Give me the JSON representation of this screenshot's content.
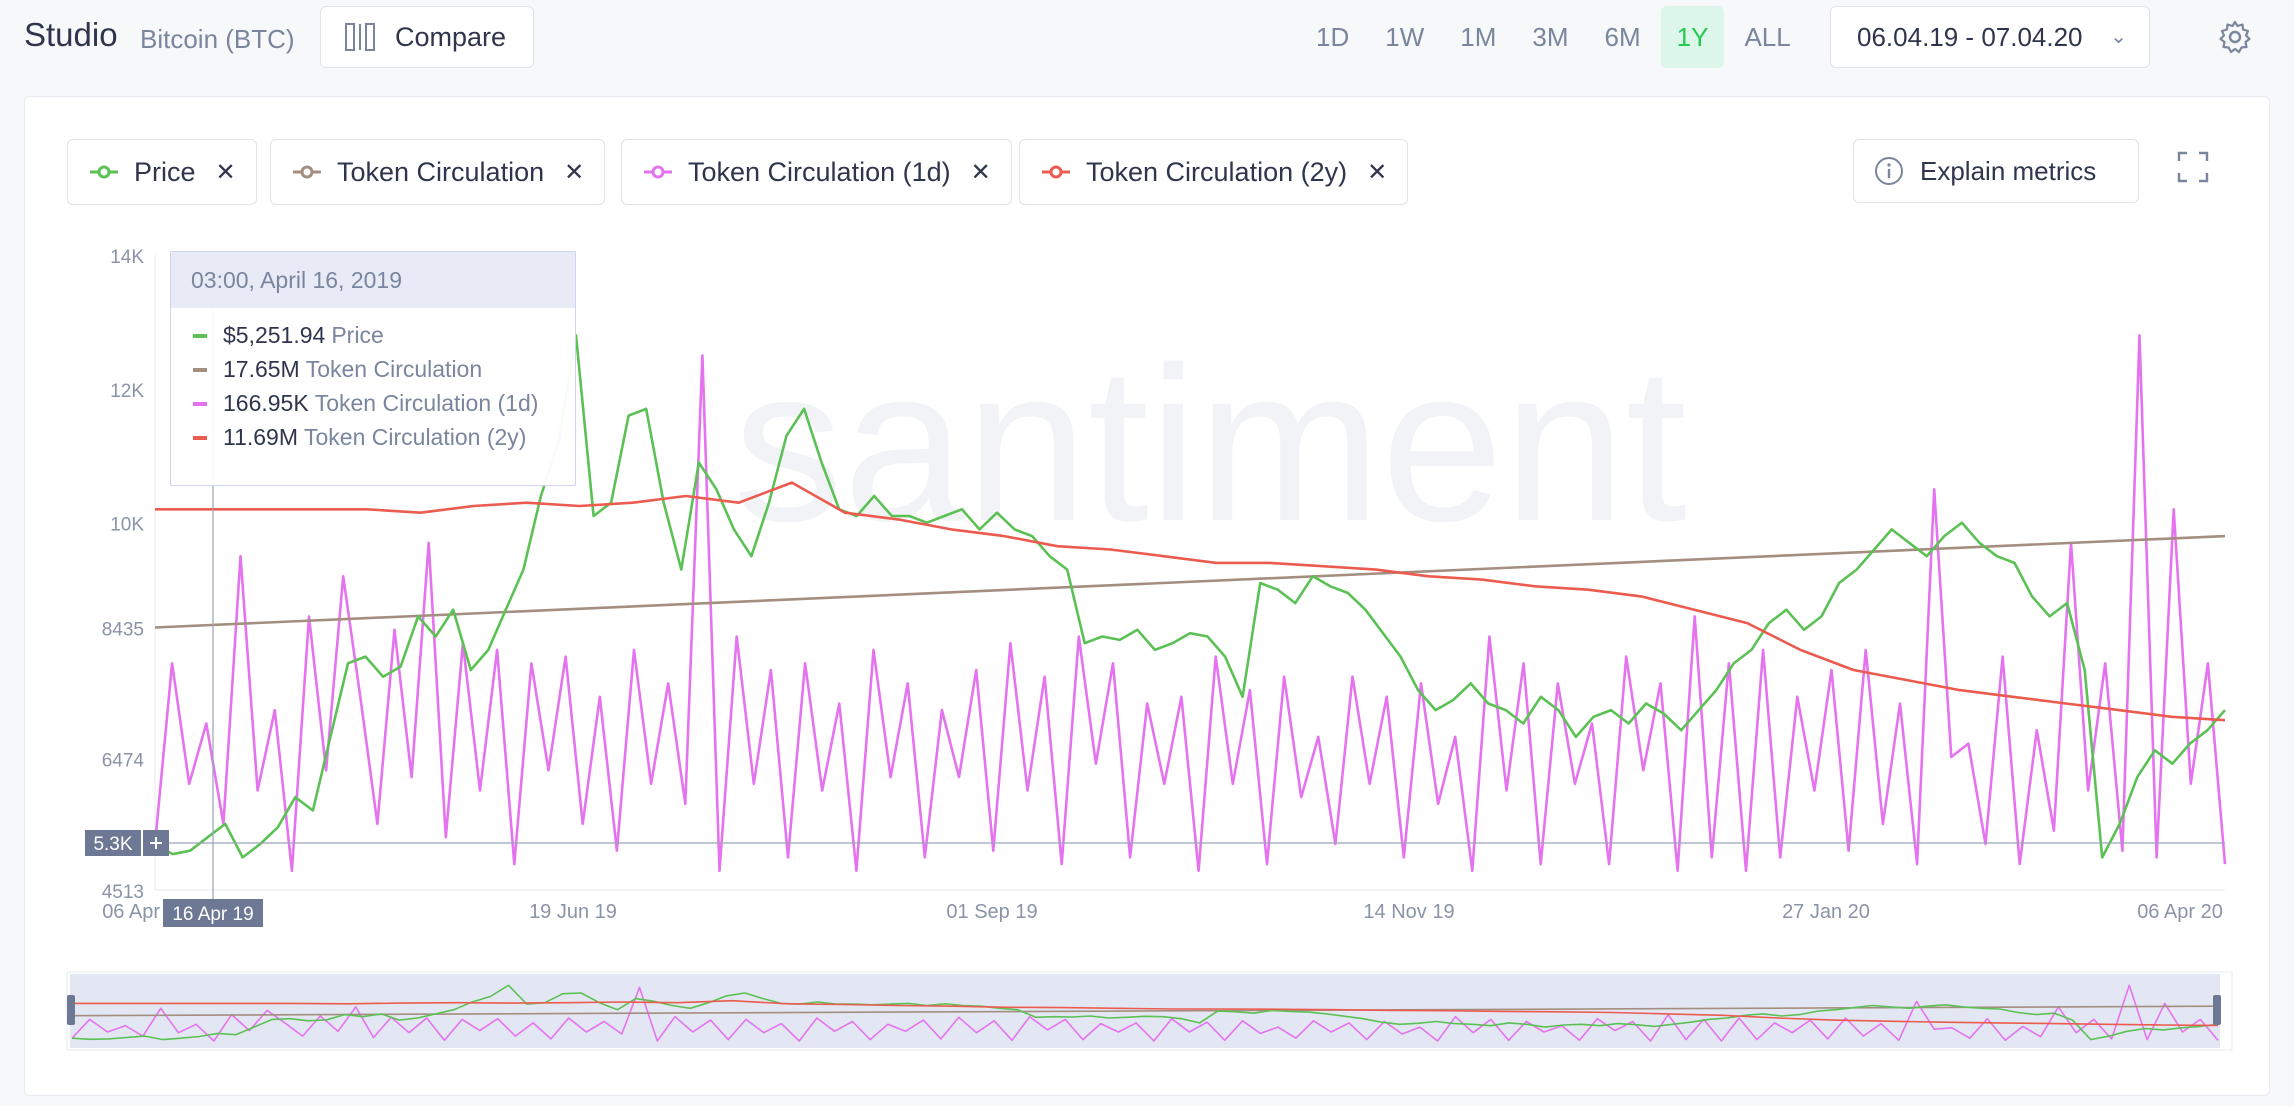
{
  "header": {
    "title": "Studio",
    "asset": "Bitcoin (BTC)",
    "compare_label": "Compare"
  },
  "ranges": [
    "1D",
    "1W",
    "1M",
    "3M",
    "6M",
    "1Y",
    "ALL"
  ],
  "active_range": "1Y",
  "date_range": "06.04.19 - 07.04.20",
  "metrics": [
    {
      "label": "Price",
      "color": "#5cc155"
    },
    {
      "label": "Token Circulation",
      "color": "#a48e7f"
    },
    {
      "label": "Token Circulation (1d)",
      "color": "#e573f0"
    },
    {
      "label": "Token Circulation (2y)",
      "color": "#ec5b4f"
    }
  ],
  "explain_label": "Explain metrics",
  "tooltip": {
    "date": "03:00, April 16, 2019",
    "rows": [
      {
        "value": "$5,251.94",
        "label": "Price",
        "color": "#5cc155"
      },
      {
        "value": "17.65M",
        "label": "Token Circulation",
        "color": "#a48e7f"
      },
      {
        "value": "166.95K",
        "label": "Token Circulation (1d)",
        "color": "#e573f0"
      },
      {
        "value": "11.69M",
        "label": "Token Circulation (2y)",
        "color": "#ec5b4f"
      }
    ]
  },
  "watermark": "santiment",
  "crosshair": {
    "y_label": "5.3K",
    "x_label": "16 Apr 19"
  },
  "chart_data": {
    "type": "line",
    "x_ticks": [
      "06 Apr 19",
      "19 Jun 19",
      "01 Sep 19",
      "14 Nov 19",
      "27 Jan 20",
      "06 Apr 20"
    ],
    "y_ticks": [
      "14K",
      "12K",
      "10K",
      "8435",
      "6474",
      "4513"
    ],
    "series": [
      {
        "name": "Price",
        "color": "#5cc155",
        "values": [
          5200,
          5050,
          5100,
          5300,
          5500,
          5000,
          5200,
          5450,
          5900,
          5700,
          6800,
          7900,
          8000,
          7700,
          7850,
          8600,
          8300,
          8700,
          7800,
          8100,
          8700,
          9300,
          10400,
          11200,
          12800,
          10100,
          10300,
          11600,
          11700,
          10300,
          9300,
          10900,
          10500,
          9900,
          9500,
          10300,
          11300,
          11700,
          10900,
          10200,
          10100,
          10400,
          10100,
          10100,
          10000,
          10100,
          10200,
          9900,
          10150,
          9900,
          9800,
          9500,
          9300,
          8200,
          8300,
          8250,
          8400,
          8100,
          8200,
          8350,
          8300,
          8000,
          7400,
          9100,
          9000,
          8800,
          9200,
          9050,
          8950,
          8700,
          8350,
          8000,
          7500,
          7200,
          7350,
          7600,
          7300,
          7200,
          7000,
          7400,
          7200,
          6800,
          7100,
          7200,
          7000,
          7300,
          7150,
          6900,
          7200,
          7500,
          7900,
          8100,
          8500,
          8700,
          8400,
          8600,
          9100,
          9300,
          9600,
          9900,
          9700,
          9500,
          9800,
          10000,
          9700,
          9500,
          9400,
          8900,
          8600,
          8800,
          7800,
          5000,
          5500,
          6200,
          6600,
          6400,
          6700,
          6900,
          7200
        ]
      },
      {
        "name": "Token Circulation",
        "color": "#a48e7f",
        "values": [
          8435,
          9800
        ]
      },
      {
        "name": "Token Circulation (1d)",
        "color": "#e573f0",
        "values": [
          5200,
          7900,
          6100,
          7000,
          5500,
          9500,
          6000,
          7200,
          4800,
          8600,
          6300,
          9200,
          7400,
          5500,
          8400,
          6200,
          9700,
          5300,
          8200,
          6000,
          8100,
          4900,
          7900,
          6300,
          8000,
          5500,
          7400,
          5100,
          8100,
          6100,
          7600,
          5800,
          12500,
          4800,
          8300,
          6100,
          7800,
          5000,
          7900,
          6000,
          7300,
          4800,
          8100,
          6200,
          7600,
          5000,
          7200,
          6200,
          7800,
          5100,
          8200,
          6000,
          7700,
          4900,
          8300,
          6400,
          7900,
          5000,
          7300,
          6100,
          7400,
          4800,
          8000,
          6100,
          7500,
          4900,
          7700,
          5900,
          6800,
          5200,
          7700,
          6100,
          7400,
          5000,
          7600,
          5800,
          6800,
          4800,
          8300,
          6000,
          7900,
          4900,
          7600,
          6100,
          7000,
          4900,
          8000,
          6300,
          7600,
          4800,
          8600,
          5000,
          7900,
          4800,
          8100,
          5000,
          7400,
          6000,
          7800,
          5100,
          8100,
          5500,
          7300,
          4900,
          10500,
          6500,
          6700,
          5200,
          8000,
          4900,
          6900,
          5400,
          9700,
          6000,
          7900,
          5100,
          12800,
          5000,
          10200,
          6100,
          7900,
          4900
        ]
      },
      {
        "name": "Token Circulation (2y)",
        "color": "#ec5b4f",
        "values": [
          10200,
          10200,
          10200,
          10200,
          10200,
          10150,
          10250,
          10300,
          10250,
          10300,
          10400,
          10300,
          10600,
          10150,
          10050,
          9900,
          9800,
          9650,
          9600,
          9500,
          9400,
          9400,
          9350,
          9300,
          9200,
          9150,
          9050,
          9000,
          8900,
          8700,
          8500,
          8100,
          7800,
          7650,
          7500,
          7400,
          7300,
          7200,
          7100,
          7050
        ]
      }
    ]
  }
}
